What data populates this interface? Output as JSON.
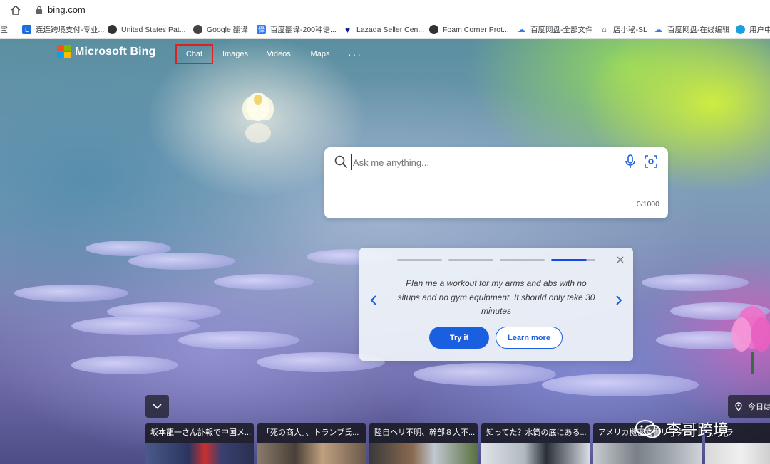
{
  "browser": {
    "url": "bing.com",
    "bookmarks": [
      {
        "label": "淘宝",
        "icon": "taobao-icon",
        "color": "#ff5000"
      },
      {
        "label": "连连跨境支付-专业...",
        "icon": "lianlian-icon",
        "color": "#1e6fd9"
      },
      {
        "label": "United States Pat...",
        "icon": "uspto-icon",
        "color": "#333333"
      },
      {
        "label": "Google 翻译",
        "icon": "google-translate-icon",
        "color": "#333333"
      },
      {
        "label": "百度翻译-200种语...",
        "icon": "baidu-translate-icon",
        "color": "#2f7cf6"
      },
      {
        "label": "Lazada Seller Cen...",
        "icon": "lazada-icon",
        "color": "#1a1a8a"
      },
      {
        "label": "Foam Corner Prot...",
        "icon": "foam-icon",
        "color": "#333333"
      },
      {
        "label": "百度网盘-全部文件",
        "icon": "baidu-pan-icon",
        "color": "#2f7cf6"
      },
      {
        "label": "店小秘-SL",
        "icon": "dianxiaomi-icon",
        "color": "#333333"
      },
      {
        "label": "百度网盘-在线编辑",
        "icon": "baidu-pan-icon",
        "color": "#2f7cf6"
      },
      {
        "label": "用户中",
        "icon": "user-center-icon",
        "color": "#1aa0e0"
      }
    ]
  },
  "header": {
    "logo_text": "Microsoft Bing",
    "nav": [
      {
        "label": "Chat"
      },
      {
        "label": "Images"
      },
      {
        "label": "Videos"
      },
      {
        "label": "Maps"
      },
      {
        "label": "···"
      }
    ]
  },
  "search": {
    "placeholder": "Ask me anything...",
    "char_count": "0/1000"
  },
  "promo": {
    "text": "Plan me a workout for my arms and abs with no situps and no gym equipment. It should only take 30 minutes",
    "try_label": "Try it",
    "learn_label": "Learn more",
    "progress_steps": 4,
    "active_step": 4
  },
  "weather": {
    "label": "今日は"
  },
  "news": [
    {
      "title": "坂本龍一さん訃報で中国メ..."
    },
    {
      "title": "「死の商人」、トランプ氏..."
    },
    {
      "title": "陸自ヘリ不明、幹部８人不..."
    },
    {
      "title": "知ってた？水筒の底にある..."
    },
    {
      "title": "アメリカ機密文書リーク..."
    },
    {
      "title": "、プラ"
    }
  ],
  "watermark": {
    "text": "李哥跨境"
  },
  "colors": {
    "accent": "#1a5fe0",
    "highlight_box": "#e02020",
    "ms_red": "#f25022",
    "ms_green": "#7fba00",
    "ms_blue": "#00a4ef",
    "ms_yellow": "#ffb900"
  }
}
